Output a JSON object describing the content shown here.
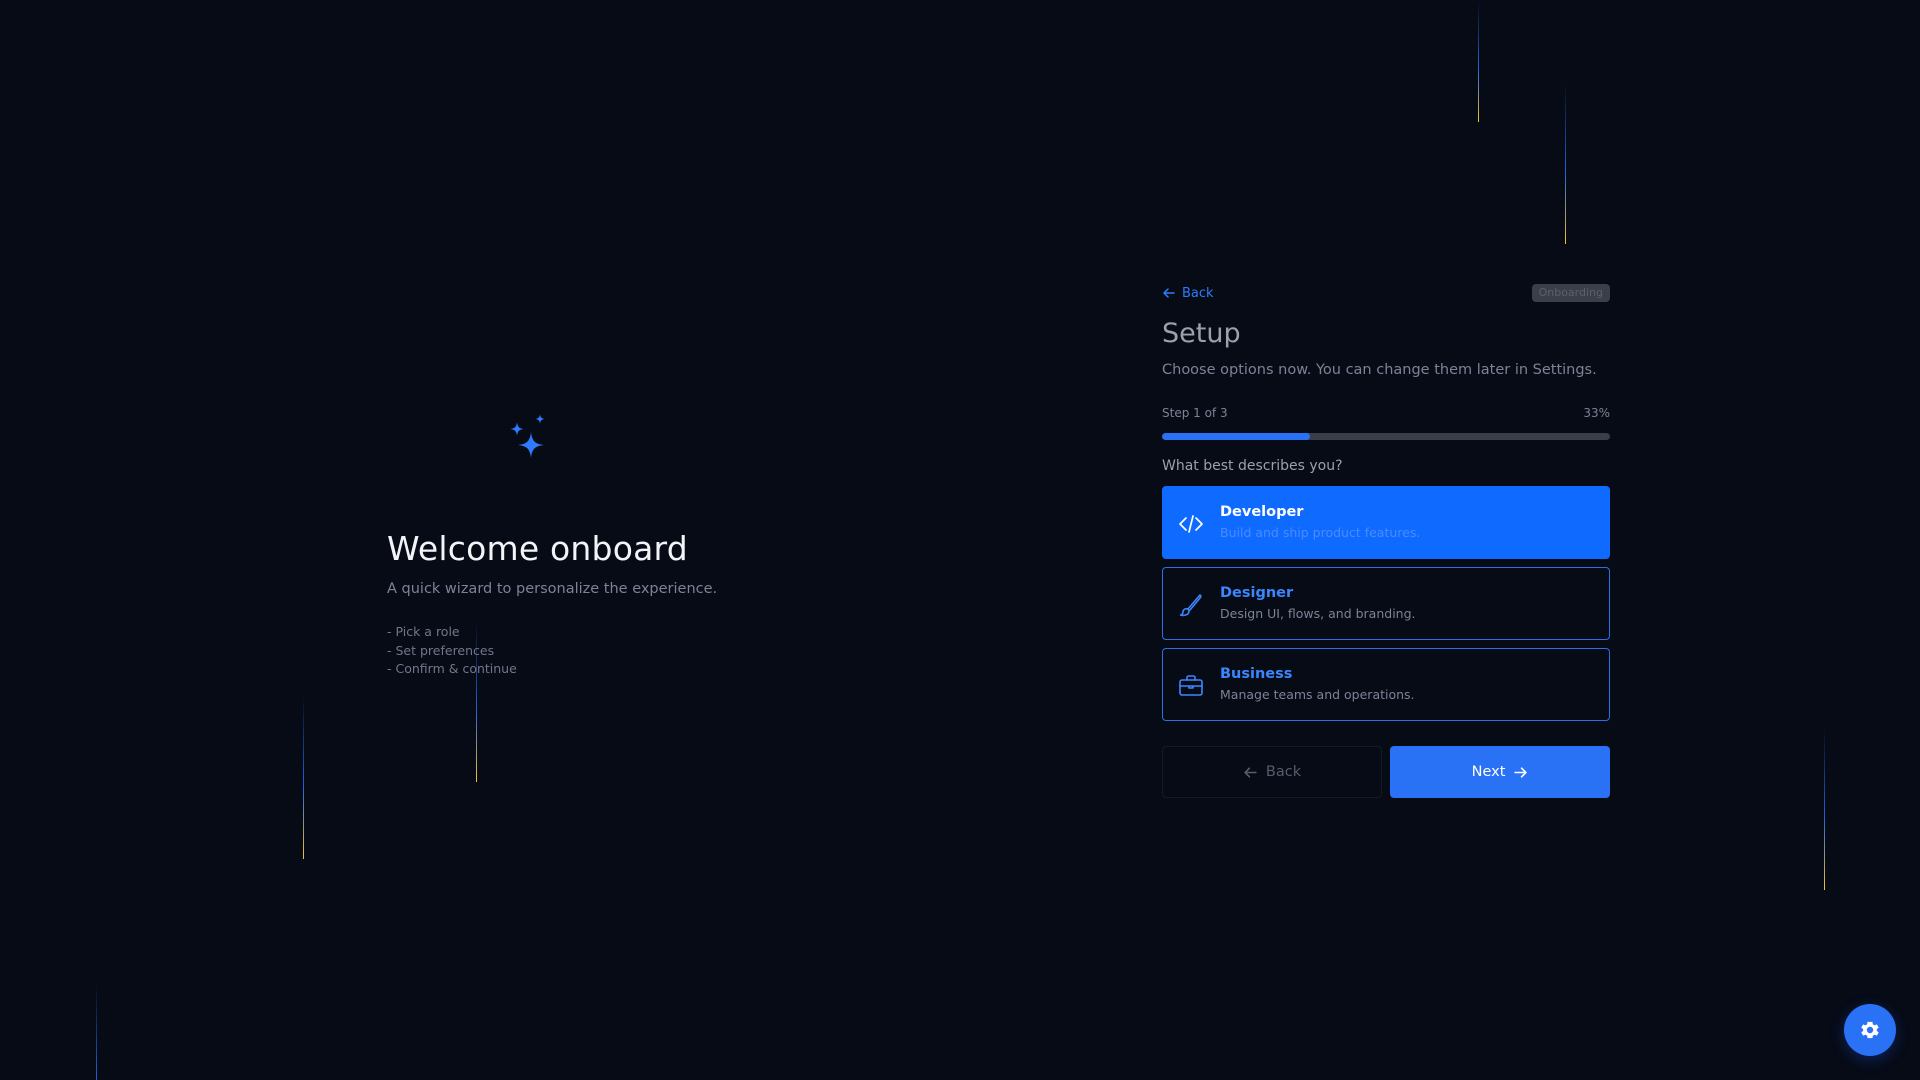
{
  "hero": {
    "icon": "sparkles-icon",
    "title": "Welcome onboard",
    "subtitle": "A quick wizard to personalize the experience.",
    "list": [
      "- Pick a role",
      "- Set preferences",
      "- Confirm & continue"
    ]
  },
  "panel": {
    "back_link": "Back",
    "badge": "Onboarding",
    "title": "Setup",
    "subtitle": "Choose options now. You can change them later in Settings.",
    "step_label": "Step 1 of 3",
    "progress_percent_label": "33%",
    "progress_fraction": 0.33,
    "question": "What best describes you?",
    "options": [
      {
        "title": "Developer",
        "description": "Build and ship product features.",
        "icon": "code-icon",
        "selected": true
      },
      {
        "title": "Designer",
        "description": "Design UI, flows, and branding.",
        "icon": "brush-icon",
        "selected": false
      },
      {
        "title": "Business",
        "description": "Manage teams and operations.",
        "icon": "briefcase-icon",
        "selected": false
      }
    ],
    "back_button": "Back",
    "next_button": "Next"
  },
  "fab": {
    "icon": "gear-icon"
  },
  "colors": {
    "background": "#070b16",
    "accent": "#2a72f5",
    "selected": "#0f6bff",
    "streak_tip": "#f2c230"
  }
}
